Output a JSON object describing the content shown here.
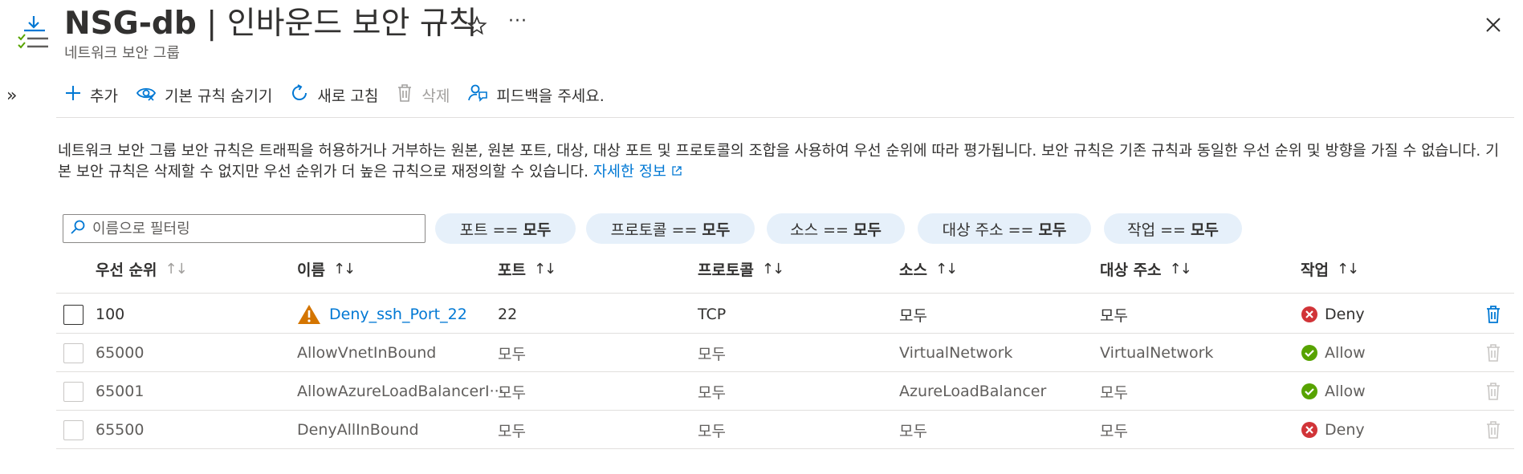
{
  "header": {
    "title_bold": "NSG-db",
    "title_rest": " | 인바운드 보안 규칙",
    "subtitle": "네트워크 보안 그룹",
    "more_label": "···",
    "expand_label": "»"
  },
  "toolbar": {
    "add_label": "추가",
    "hide_default_label": "기본 규칙 숨기기",
    "refresh_label": "새로 고침",
    "delete_label": "삭제",
    "feedback_label": "피드백을 주세요."
  },
  "description": {
    "text": "네트워크 보안 그룹 보안 규칙은 트래픽을 허용하거나 거부하는 원본, 원본 포트, 대상, 대상 포트 및 프로토콜의 조합을 사용하여 우선 순위에 따라 평가됩니다. 보안 규칙은 기존 규칙과 동일한 우선 순위 및 방향을 가질 수 없습니다. 기본 보안 규칙은 삭제할 수 없지만 우선 순위가 더 높은 규칙으로 재정의할 수 있습니다.",
    "link_label": "자세한 정보"
  },
  "filters": {
    "search_placeholder": "이름으로 필터링",
    "pills": [
      {
        "label": "포트 ==",
        "value": "모두"
      },
      {
        "label": "프로토콜 ==",
        "value": "모두"
      },
      {
        "label": "소스 ==",
        "value": "모두"
      },
      {
        "label": "대상 주소 ==",
        "value": "모두"
      },
      {
        "label": "작업 ==",
        "value": "모두"
      }
    ]
  },
  "table": {
    "columns": [
      "우선 순위",
      "이름",
      "포트",
      "프로토콜",
      "소스",
      "대상 주소",
      "작업"
    ],
    "rows": [
      {
        "priority": "100",
        "name": "Deny_ssh_Port_22",
        "port": "22",
        "protocol": "TCP",
        "source": "모두",
        "destination": "모두",
        "action": "Deny",
        "warning": true
      },
      {
        "priority": "65000",
        "name": "AllowVnetInBound",
        "port": "모두",
        "protocol": "모두",
        "source": "VirtualNetwork",
        "destination": "VirtualNetwork",
        "action": "Allow",
        "warning": false
      },
      {
        "priority": "65001",
        "name": "AllowAzureLoadBalancerI···",
        "port": "모두",
        "protocol": "모두",
        "source": "AzureLoadBalancer",
        "destination": "모두",
        "action": "Allow",
        "warning": false
      },
      {
        "priority": "65500",
        "name": "DenyAllInBound",
        "port": "모두",
        "protocol": "모두",
        "source": "모두",
        "destination": "모두",
        "action": "Deny",
        "warning": false
      }
    ]
  },
  "colors": {
    "accent": "#0078d4",
    "deny": "#d13438",
    "allow": "#57a300",
    "warning": "#d47500",
    "pill_bg": "#e6f0fa"
  },
  "icons": {
    "header": "security-rules-icon",
    "star": "star-icon",
    "close": "close-icon",
    "add": "plus-icon",
    "hide": "eye-hide-icon",
    "refresh": "refresh-icon",
    "delete": "trash-icon",
    "feedback": "feedback-icon",
    "external": "external-link-icon",
    "search": "search-icon",
    "warning": "warning-icon",
    "deny": "deny-icon",
    "allow": "allow-icon"
  }
}
